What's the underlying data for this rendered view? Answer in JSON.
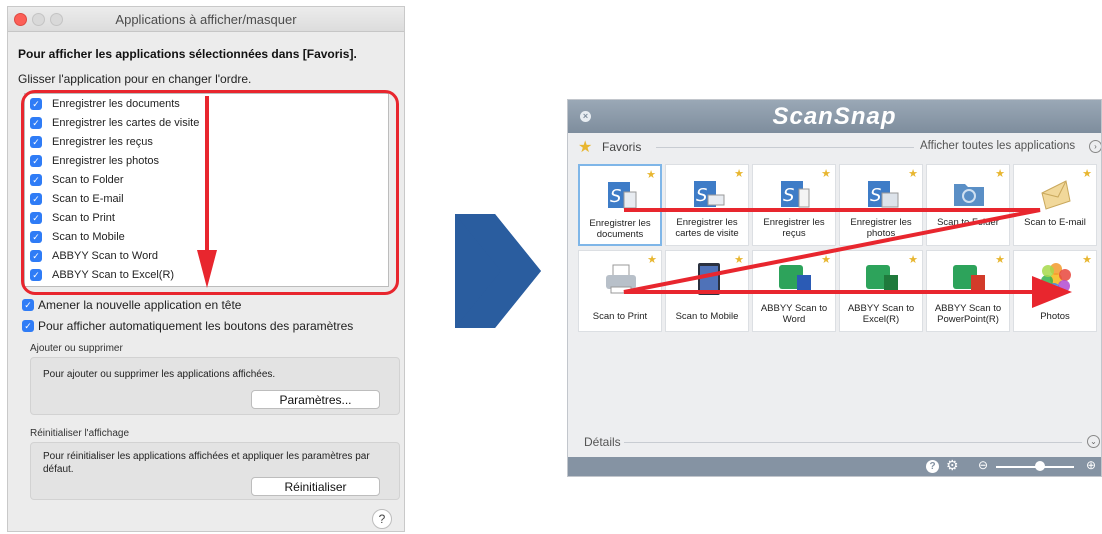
{
  "dialog": {
    "title": "Applications à afficher/masquer",
    "heading": "Pour afficher les applications sélectionnées dans [Favoris].",
    "subheading": "Glisser l'application pour en changer l'ordre.",
    "apps": [
      {
        "label": "Enregistrer les documents",
        "checked": true
      },
      {
        "label": "Enregistrer les cartes de visite",
        "checked": true
      },
      {
        "label": "Enregistrer les reçus",
        "checked": true
      },
      {
        "label": "Enregistrer les photos",
        "checked": true
      },
      {
        "label": "Scan to Folder",
        "checked": true
      },
      {
        "label": "Scan to E-mail",
        "checked": true
      },
      {
        "label": "Scan to Print",
        "checked": true
      },
      {
        "label": "Scan to Mobile",
        "checked": true
      },
      {
        "label": "ABBYY Scan to Word",
        "checked": true
      },
      {
        "label": "ABBYY Scan to Excel(R)",
        "checked": true
      }
    ],
    "option_new_first": "Amener la nouvelle application en tête",
    "option_auto_buttons": "Pour afficher automatiquement les boutons des paramètres",
    "add_remove_title": "Ajouter ou supprimer",
    "add_remove_text": "Pour ajouter ou supprimer les applications affichées.",
    "settings_button": "Paramètres...",
    "reset_title": "Réinitialiser l'affichage",
    "reset_text": "Pour réinitialiser les applications affichées et appliquer les paramètres par défaut.",
    "reset_button": "Réinitialiser",
    "help": "?"
  },
  "scansnap": {
    "logo": "ScanSnap",
    "favorites_label": "Favoris",
    "all_apps_label": "Afficher toutes les applications",
    "details_label": "Détails",
    "tiles": [
      {
        "label": "Enregistrer les documents",
        "icon": "document-scan-icon",
        "selected": true
      },
      {
        "label": "Enregistrer les cartes de visite",
        "icon": "business-card-icon"
      },
      {
        "label": "Enregistrer les reçus",
        "icon": "receipt-icon"
      },
      {
        "label": "Enregistrer les photos",
        "icon": "photo-scan-icon"
      },
      {
        "label": "Scan to Folder",
        "icon": "folder-icon"
      },
      {
        "label": "Scan to E-mail",
        "icon": "envelope-icon"
      },
      {
        "label": "Scan to Print",
        "icon": "printer-icon"
      },
      {
        "label": "Scan to Mobile",
        "icon": "tablet-icon"
      },
      {
        "label": "ABBYY Scan to Word",
        "icon": "abbyy-word-icon"
      },
      {
        "label": "ABBYY Scan to Excel(R)",
        "icon": "abbyy-excel-icon"
      },
      {
        "label": "ABBYY Scan to PowerPoint(R)",
        "icon": "abbyy-powerpoint-icon"
      },
      {
        "label": "Photos",
        "icon": "photos-icon"
      }
    ]
  },
  "colors": {
    "annotation_red": "#e8262e",
    "arrow_blue": "#2a5d9f",
    "checkbox_blue": "#2f7cf6",
    "star_gold": "#e8b630"
  }
}
